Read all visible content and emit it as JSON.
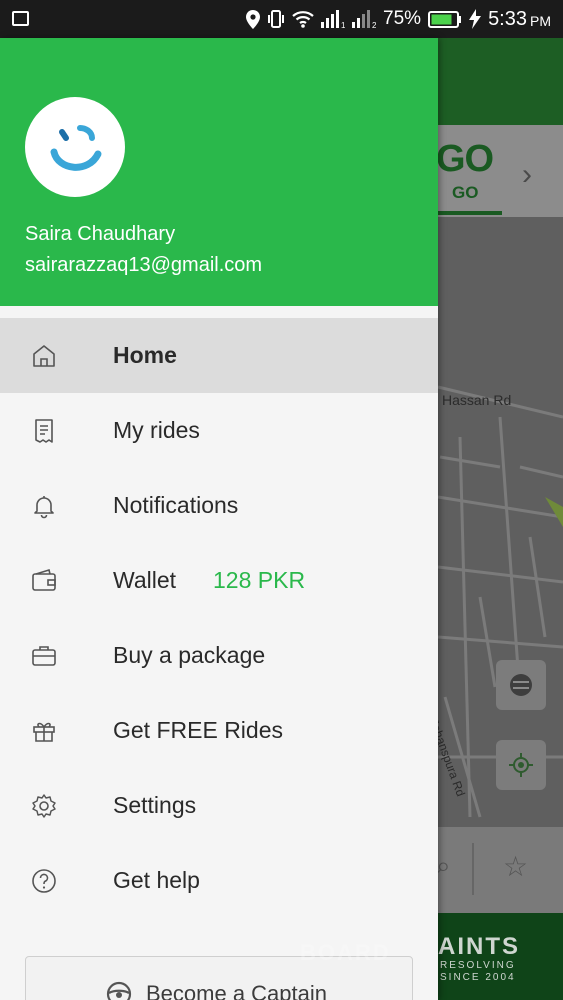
{
  "status_bar": {
    "battery": "75%",
    "time": "5:33",
    "ampm": "PM",
    "sim1": "1",
    "sim2": "2"
  },
  "background_app": {
    "go_big": "GO",
    "go_small": "GO",
    "road_labels": [
      "Hassan Rd",
      "Jahanspura Rd"
    ],
    "banner_title": "AINTS",
    "banner_sub_1": "RESOLVING",
    "banner_sub_2": "SINCE 2004"
  },
  "drawer": {
    "user": {
      "name": "Saira Chaudhary",
      "email": "sairarazzaq13@gmail.com"
    },
    "menu": [
      {
        "label": "Home",
        "icon": "home-icon",
        "active": true
      },
      {
        "label": "My rides",
        "icon": "receipt-icon"
      },
      {
        "label": "Notifications",
        "icon": "bell-icon"
      },
      {
        "label": "Wallet",
        "icon": "wallet-icon",
        "badge": "128 PKR"
      },
      {
        "label": "Buy a package",
        "icon": "briefcase-icon"
      },
      {
        "label": "Get FREE Rides",
        "icon": "gift-icon"
      },
      {
        "label": "Settings",
        "icon": "gear-icon"
      },
      {
        "label": "Get help",
        "icon": "help-icon"
      }
    ],
    "captain_button": "Become a Captain"
  },
  "watermark": "BOARD",
  "colors": {
    "brand_green": "#2ab84b",
    "status_bar": "#1b1b1b",
    "active_item": "#dcdcdc"
  }
}
